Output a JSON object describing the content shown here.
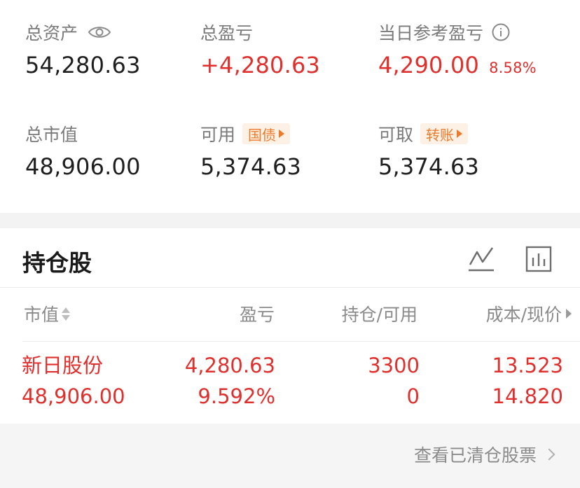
{
  "summary": {
    "total_assets": {
      "label": "总资产",
      "value": "54,280.63"
    },
    "total_pnl": {
      "label": "总盈亏",
      "value": "+4,280.63"
    },
    "daily_pnl": {
      "label": "当日参考盈亏",
      "value": "4,290.00",
      "percent": "8.58%"
    },
    "market_value": {
      "label": "总市值",
      "value": "48,906.00"
    },
    "available": {
      "label": "可用",
      "tag": "国债",
      "value": "5,374.63"
    },
    "withdrawable": {
      "label": "可取",
      "tag": "转账",
      "value": "5,374.63"
    }
  },
  "holdings": {
    "title": "持仓股",
    "columns": [
      "市值",
      "盈亏",
      "持仓/可用",
      "成本/现价"
    ],
    "rows": [
      {
        "name": "新日股份",
        "market_value": "48,906.00",
        "pnl": "4,280.63",
        "pnl_pct": "9.592%",
        "position": "3300",
        "available": "0",
        "cost": "13.523",
        "price": "14.820"
      }
    ]
  },
  "footer": {
    "link": "查看已清仓股票"
  },
  "colors": {
    "up": "#e0302e",
    "tag_text": "#ee7a2b",
    "tag_bg": "#fdf1e6"
  },
  "icons": [
    "eye-icon",
    "info-icon",
    "line-chart-icon",
    "bar-chart-icon",
    "sort-icon",
    "chevron-right-icon"
  ]
}
